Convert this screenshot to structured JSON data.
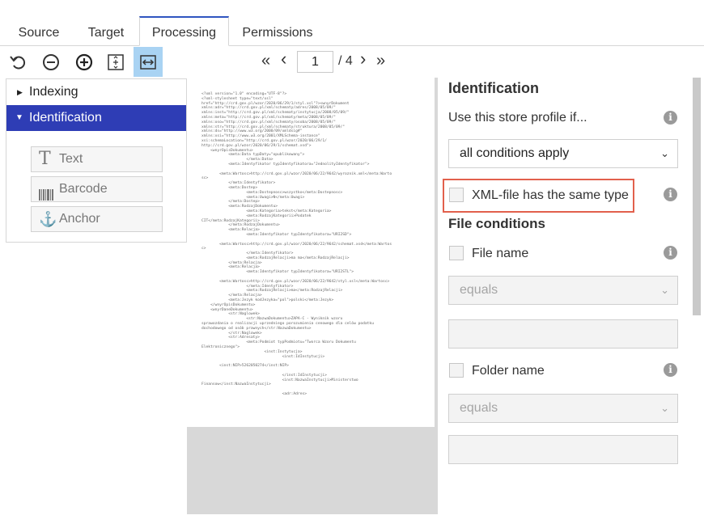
{
  "tabs": [
    {
      "label": "Source"
    },
    {
      "label": "Target"
    },
    {
      "label": "Processing",
      "active": true
    },
    {
      "label": "Permissions"
    }
  ],
  "toolbar": {
    "icons": [
      "undo-icon",
      "zoom-out-icon",
      "zoom-in-icon",
      "fit-page-icon",
      "fit-width-icon"
    ]
  },
  "pager": {
    "first": "«",
    "prev": "‹",
    "current": "1",
    "total": "/ 4",
    "next": "›",
    "last": "»"
  },
  "tree": {
    "items": [
      {
        "label": "Indexing",
        "expanded": false
      },
      {
        "label": "Identification",
        "expanded": true
      }
    ],
    "tools": [
      {
        "label": "Text",
        "icon": "T"
      },
      {
        "label": "Barcode",
        "icon": "barcode-icon"
      },
      {
        "label": "Anchor",
        "icon": "⚓"
      }
    ]
  },
  "document": {
    "lines": "<?xml version=\"1.0\" encoding=\"UTF-8\"?>\n<?xml-stylesheet type=\"text/xsl\"\nhref=\"http://crd.gov.pl/wzor/2020/06/29/1/styl.xsl\"?><wnyrDokument\nxmlns:adr=\"http://crd.gov.pl/xml/schematy/adres/2008/05/09/\"\nxmlns:inst=\"http://crd.gov.pl/xml/schematy/instytucja/2008/05/09/\"\nxmlns:meta=\"http://crd.gov.pl/xml/schematy/meta/2008/05/09/\"\nxmlns:oso=\"http://crd.gov.pl/xml/schematy/osoba/2008/05/09/\"\nxmlns:str=\"http://crd.gov.pl/xml/schematy/struktura/2008/05/09/\"\nxmlns:ds=\"http://www.w3.org/2000/09/xmldsig#\"\nxmlns:xsi=\"http://www.w3.org/2001/XMLSchema-instance\"\nxsi:schemaLocation=\"http://crd.gov.pl/wzor/2020/06/29/1/\nhttp://crd.gov.pl/wzor/2020/06/29/1/schemat.xsd\">\n    <wnyrOpisDokumentu>\n            <meta:Data typDaty=\"opublikowany\">\n                    </meta:Data>\n            <meta:Identyfikator typIdentyfikatora=\"JednolityIdentyfikator\">\n\n        <meta:Wartosc>http://crd.gov.pl/wzor/2020/06/22/9642/wyroznik.xml</meta:Warto\nsc>\n            </meta:Identyfikator>\n            <meta:Dostep>\n                    <meta:Dostepnosc>wszystko</meta:Dostepnosc>\n                    <meta:Uwagi>N</meta:Uwagi>\n            </meta:Dostep>\n            <meta:RodzajDokumentu>\n                    <meta:Kategoria>tekst</meta:Kategoria>\n                    <meta:RodzajKategorii>Podatek\nCIT</meta:RodzajKategorii>\n            </meta:RodzajDokumentu>\n            <meta:Relacja>\n                    <meta:Identyfikator typIdentyfikatora=\"URI2SD\">\n\n        <meta:Wartosc>http://crd.gov.pl/wzor/2020/06/22/9642/schemat.xsd</meta:Wartos\nc>\n                    </meta:Identyfikator>\n                    <meta:RodzajRelacji>ma ma</meta:RodzajRelacji>\n            </meta:Relacja>\n            <meta:Relacja>\n                    <meta:Identyfikator typIdentyfikatora=\"URI2STL\">\n\n        <meta:Wartosc>http://crd.gov.pl/wzor/2020/06/22/9642/styl.xsl</meta:Wartosc>\n                    </meta:Identyfikator>\n                    <meta:RodzajRelacji>ma</meta:RodzajRelacji>\n            </meta:Relacja>\n            <meta:Jezyk kodJezyka=\"pol\">polski</meta:Jezyk>\n    </wnyrOpisDokumentu>\n    <wnyrDaneDokumentu>\n            <str:Naglowek>\n                    <str:NazwaDokumentu>ZAPA-C - Wyniknik wzoru\nsprawozdania o realizacji uprzedniego porozumienia cenowego dla celów podatku\ndochodowego od osób prawnych</str:NazwaDokumentu>\n            </str:Naglowek>\n            <str:Adresaty>\n                    <meta:Podmiot typPodmiotu=\"Tworca Wzoru Dokumentu\nElektronicznego\">\n                            <inst:Instytucja>\n                                    <inst:IdInstytucji>\n\n        <inst:NIP>5262050274</inst:NIP>\n\n                                    </inst:IdInstytucji>\n                                    <inst:NazwaInstytucji>Ministerstwo\nFinansow</inst:NazwaInstytucji>\n\n                                    <adr:Adres>"
  },
  "panel": {
    "title": "Identification",
    "use_profile_label": "Use this store profile if...",
    "conditions_select": "all conditions apply",
    "same_type_label": "XML-file has the same type",
    "file_conditions_title": "File conditions",
    "file_name_label": "File name",
    "file_name_operator": "equals",
    "folder_name_label": "Folder name",
    "folder_name_operator": "equals",
    "info_glyph": "i",
    "chevron": "⌄"
  },
  "colors": {
    "accent": "#2f55c0",
    "tree_selected": "#2e3db5",
    "toolbar_active": "#a9d3f3",
    "highlight_border": "#e2604c"
  }
}
